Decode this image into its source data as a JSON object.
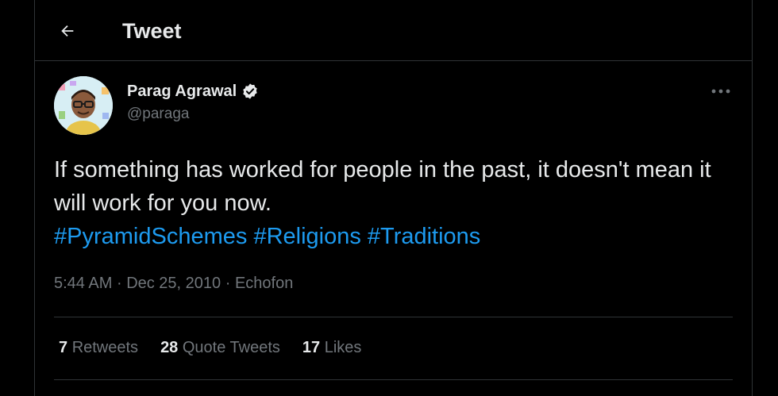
{
  "header": {
    "title": "Tweet",
    "back_icon": "arrow-left-icon"
  },
  "tweet": {
    "author_name": "Parag Agrawal",
    "handle": "@paraga",
    "verified": true,
    "text_plain": "If something has worked for people in the past, it doesn't mean it will work for you now.",
    "hashtags": [
      "#PyramidSchemes",
      "#Religions",
      "#Traditions"
    ],
    "time": "5:44 AM",
    "date": "Dec 25, 2010",
    "source": "Echofon",
    "separator": "·"
  },
  "stats": {
    "retweets_count": "7",
    "retweets_label": "Retweets",
    "quotes_count": "28",
    "quotes_label": "Quote Tweets",
    "likes_count": "17",
    "likes_label": "Likes"
  },
  "colors": {
    "background": "#000000",
    "text": "#e7e9ea",
    "muted": "#71767b",
    "accent": "#1d9bf0",
    "border": "#2f3336"
  }
}
